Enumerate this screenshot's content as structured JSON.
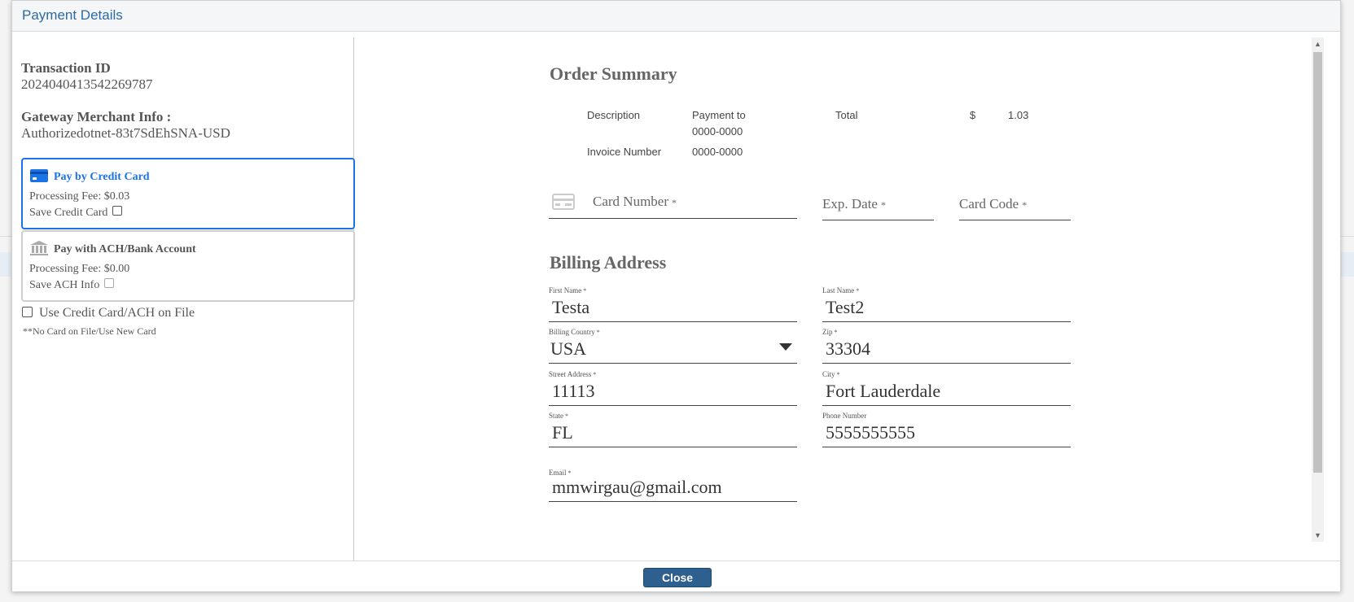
{
  "modal": {
    "title": "Payment Details"
  },
  "transaction": {
    "id_label": "Transaction ID",
    "id_value": "2024040413542269787",
    "merchant_label": "Gateway Merchant Info :",
    "merchant_value": "Authorizedotnet-83t7SdEhSNA-USD"
  },
  "payment_options": {
    "credit": {
      "title": "Pay by Credit Card",
      "fee": "Processing Fee: $0.03",
      "save_label": "Save Credit Card",
      "selected": true
    },
    "ach": {
      "title": "Pay with ACH/Bank Account",
      "fee": "Processing Fee: $0.00",
      "save_label": "Save ACH Info",
      "selected": false
    },
    "on_file_label": "Use Credit Card/ACH on File",
    "on_file_note": "**No Card on File/Use New Card"
  },
  "order_summary": {
    "title": "Order Summary",
    "description_label": "Description",
    "description_value_line1": "Payment to",
    "description_value_line2": "0000-0000",
    "total_label": "Total",
    "currency": "$",
    "total_value": "1.03",
    "invoice_label": "Invoice Number",
    "invoice_value": "0000-0000"
  },
  "card": {
    "number_label": "Card Number",
    "exp_label": "Exp. Date",
    "code_label": "Card Code",
    "required_mark": "*"
  },
  "billing": {
    "title": "Billing Address",
    "first_name": {
      "label": "First Name",
      "value": "Testa"
    },
    "last_name": {
      "label": "Last Name",
      "value": "Test2"
    },
    "country": {
      "label": "Billing Country",
      "value": "USA"
    },
    "zip": {
      "label": "Zip",
      "value": "33304"
    },
    "street": {
      "label": "Street Address",
      "value": "11113"
    },
    "city": {
      "label": "City",
      "value": "Fort Lauderdale"
    },
    "state": {
      "label": "State",
      "value": "FL"
    },
    "phone": {
      "label": "Phone Number",
      "value": "5555555555"
    },
    "email": {
      "label": "Email",
      "value": "mmwirgau@gmail.com"
    },
    "required_mark": "*"
  },
  "footer": {
    "close_label": "Close"
  },
  "colors": {
    "accent": "#1a73e8",
    "title": "#2d6aa3",
    "button": "#2d5f8f"
  },
  "icons": {
    "credit": "credit-card-icon",
    "ach": "bank-icon",
    "card_field": "card-icon",
    "dropdown": "caret-down-icon"
  }
}
